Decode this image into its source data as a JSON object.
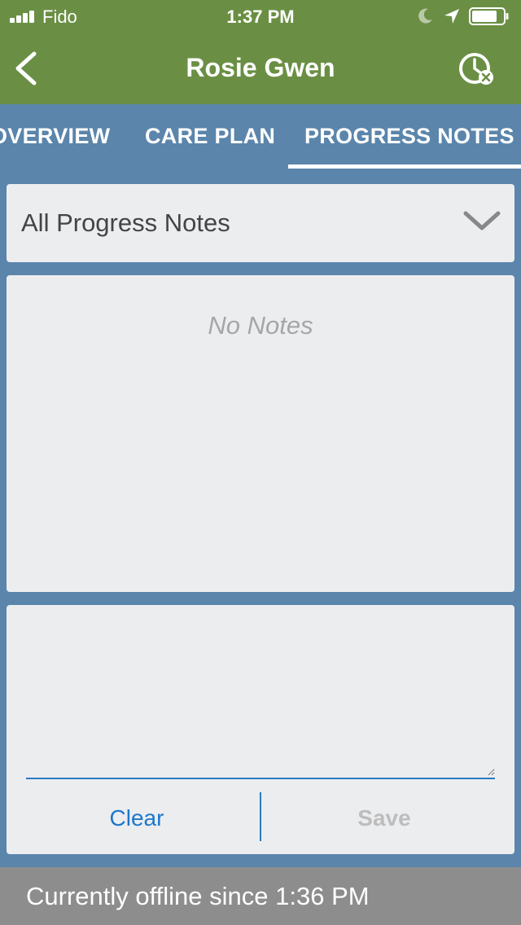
{
  "status_bar": {
    "carrier": "Fido",
    "time": "1:37 PM",
    "icons": [
      "signal-icon",
      "moon-icon",
      "location-arrow-icon",
      "battery-icon"
    ]
  },
  "nav": {
    "title": "Rosie Gwen",
    "back_icon": "chevron-left-icon",
    "history_icon": "clock-cancel-icon"
  },
  "tabs": {
    "items": [
      {
        "label": "OVERVIEW"
      },
      {
        "label": "CARE PLAN"
      },
      {
        "label": "PROGRESS NOTES",
        "selected": true
      }
    ]
  },
  "filter": {
    "selected": "All Progress Notes",
    "icon": "chevron-down-icon"
  },
  "notes": {
    "empty_text": "No Notes"
  },
  "editor": {
    "value": "",
    "placeholder": "",
    "clear_label": "Clear",
    "save_label": "Save"
  },
  "offline_banner": {
    "text": "Currently offline since 1:36 PM"
  },
  "colors": {
    "nav_green": "#6a8f44",
    "tab_blue": "#5b85ab",
    "card_bg": "#ecedef",
    "action_blue": "#1c77cc",
    "disabled_gray": "#bdbdbd",
    "banner_gray": "#8d8d8d"
  }
}
